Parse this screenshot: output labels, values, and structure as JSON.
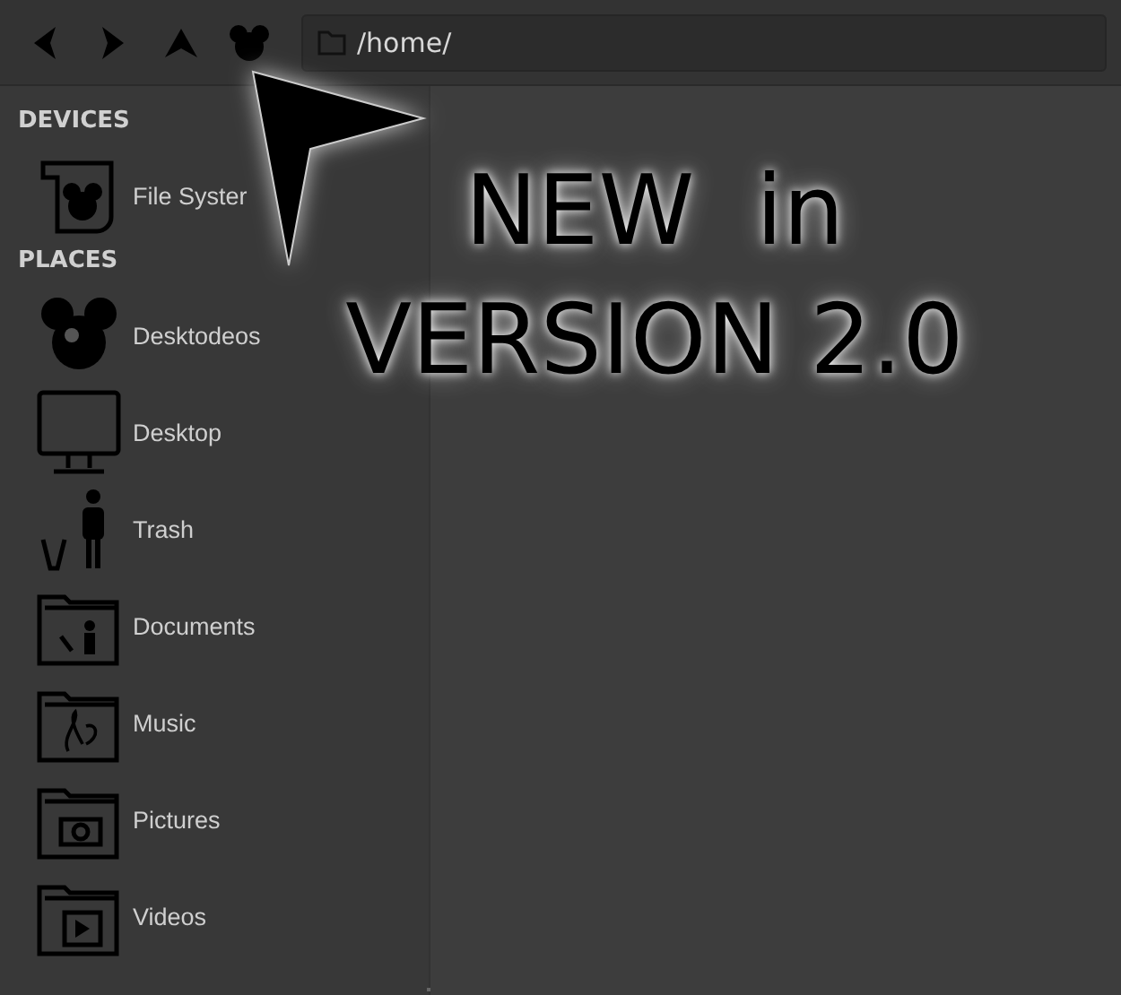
{
  "toolbar": {
    "path": "/home/"
  },
  "sidebar": {
    "sections": [
      {
        "heading": "DEVICES",
        "items": [
          {
            "kind": "drive",
            "label": "File Syster"
          }
        ]
      },
      {
        "heading": "PLACES",
        "items": [
          {
            "kind": "home",
            "label": "Desktodeos"
          },
          {
            "kind": "desktop",
            "label": "Desktop"
          },
          {
            "kind": "trash",
            "label": "Trash"
          },
          {
            "kind": "documents",
            "label": "Documents"
          },
          {
            "kind": "music",
            "label": "Music"
          },
          {
            "kind": "pictures",
            "label": "Pictures"
          },
          {
            "kind": "videos",
            "label": "Videos"
          }
        ]
      }
    ]
  },
  "annotation": {
    "lines": [
      "NEW  in",
      "VERSION 2.0"
    ]
  }
}
